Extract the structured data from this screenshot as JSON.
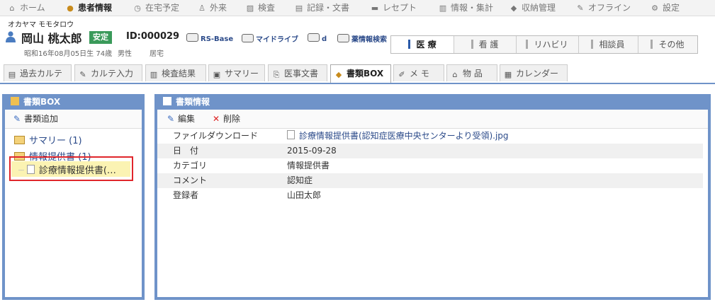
{
  "topnav": [
    {
      "label": "ホーム",
      "icon": "home-icon",
      "glyph": "⌂"
    },
    {
      "label": "患者情報",
      "icon": "patient-icon",
      "glyph": "●"
    },
    {
      "label": "在宅予定",
      "icon": "clock-icon",
      "glyph": "◷"
    },
    {
      "label": "外来",
      "icon": "person-icon",
      "glyph": "♙"
    },
    {
      "label": "検査",
      "icon": "chart-icon",
      "glyph": "▨"
    },
    {
      "label": "記録・文書",
      "icon": "record-icon",
      "glyph": "▤"
    },
    {
      "label": "レセプト",
      "icon": "receipt-icon",
      "glyph": "▬"
    },
    {
      "label": "情報・集計",
      "icon": "stats-icon",
      "glyph": "▥"
    },
    {
      "label": "収納管理",
      "icon": "cash-icon",
      "glyph": "◆"
    },
    {
      "label": "オフライン",
      "icon": "offline-icon",
      "glyph": "✎"
    },
    {
      "label": "設定",
      "icon": "settings-icon",
      "glyph": "⚙"
    }
  ],
  "patient": {
    "kana": "オカヤマ モモタロウ",
    "name": "岡山 桃太郎",
    "status": "安定",
    "id": "ID:000029",
    "birth": "昭和16年08月05日生 74歳",
    "sex": "男性",
    "residence": "居宅"
  },
  "links": [
    "RS-Base",
    "マイドライブ",
    "d",
    "薬情報検索"
  ],
  "roles": [
    "医 療",
    "看 護",
    "リハビリ",
    "相談員",
    "その他"
  ],
  "tabs": [
    "過去カルテ",
    "カルテ入力",
    "検査結果",
    "サマリー",
    "医事文書",
    "書類BOX",
    "メ モ",
    "物 品",
    "カレンダー"
  ],
  "left_panel": {
    "title": "書類BOX",
    "add_label": "書類追加",
    "folders": [
      {
        "label": "サマリー (1)"
      },
      {
        "label": "情報提供書 (1)"
      }
    ],
    "doc_label": "診療情報提供書(…"
  },
  "right_panel": {
    "title": "書類情報",
    "edit_label": "編集",
    "delete_label": "削除",
    "rows": [
      {
        "key": "ファイルダウンロード",
        "value": "診療情報提供書(認知症医療中央センターより受領).jpg"
      },
      {
        "key": "日　付",
        "value": "2015-09-28"
      },
      {
        "key": "カテゴリ",
        "value": "情報提供書"
      },
      {
        "key": "コメント",
        "value": "認知症"
      },
      {
        "key": "登録者",
        "value": "山田太郎"
      }
    ]
  },
  "colors": {
    "accent": "#6f93c9",
    "badge": "#3a9a5a",
    "highlight": "#e0262b"
  }
}
